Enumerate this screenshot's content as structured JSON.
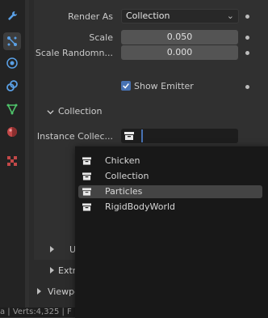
{
  "render_as": {
    "label": "Render As",
    "value": "Collection"
  },
  "scale": {
    "label": "Scale",
    "value": "0.050"
  },
  "scale_random": {
    "label": "Scale Randomn...",
    "value": "0.000"
  },
  "show_emitter": {
    "label": "Show Emitter",
    "checked": true
  },
  "collection_panel": {
    "title": "Collection"
  },
  "instance_collection": {
    "label": "Instance Collec..."
  },
  "dropdown": {
    "items": [
      {
        "label": "Chicken",
        "highlighted": false
      },
      {
        "label": "Collection",
        "highlighted": false
      },
      {
        "label": "Particles",
        "highlighted": true
      },
      {
        "label": "RigidBodyWorld",
        "highlighted": false
      }
    ]
  },
  "collapsed_panels": [
    {
      "label": "U"
    },
    {
      "label": "Extr"
    },
    {
      "label": "Viewpo"
    }
  ],
  "status_bar": {
    "text": "a | Verts:4,325 | F"
  },
  "colors": {
    "accent": "#4772b3",
    "panel": "#303030",
    "popup": "#181818"
  },
  "icons": [
    "wrench-icon",
    "particles-icon",
    "physics-icon",
    "constraints-icon",
    "object-data-icon",
    "material-icon",
    "texture-icon",
    "collection-icon"
  ]
}
